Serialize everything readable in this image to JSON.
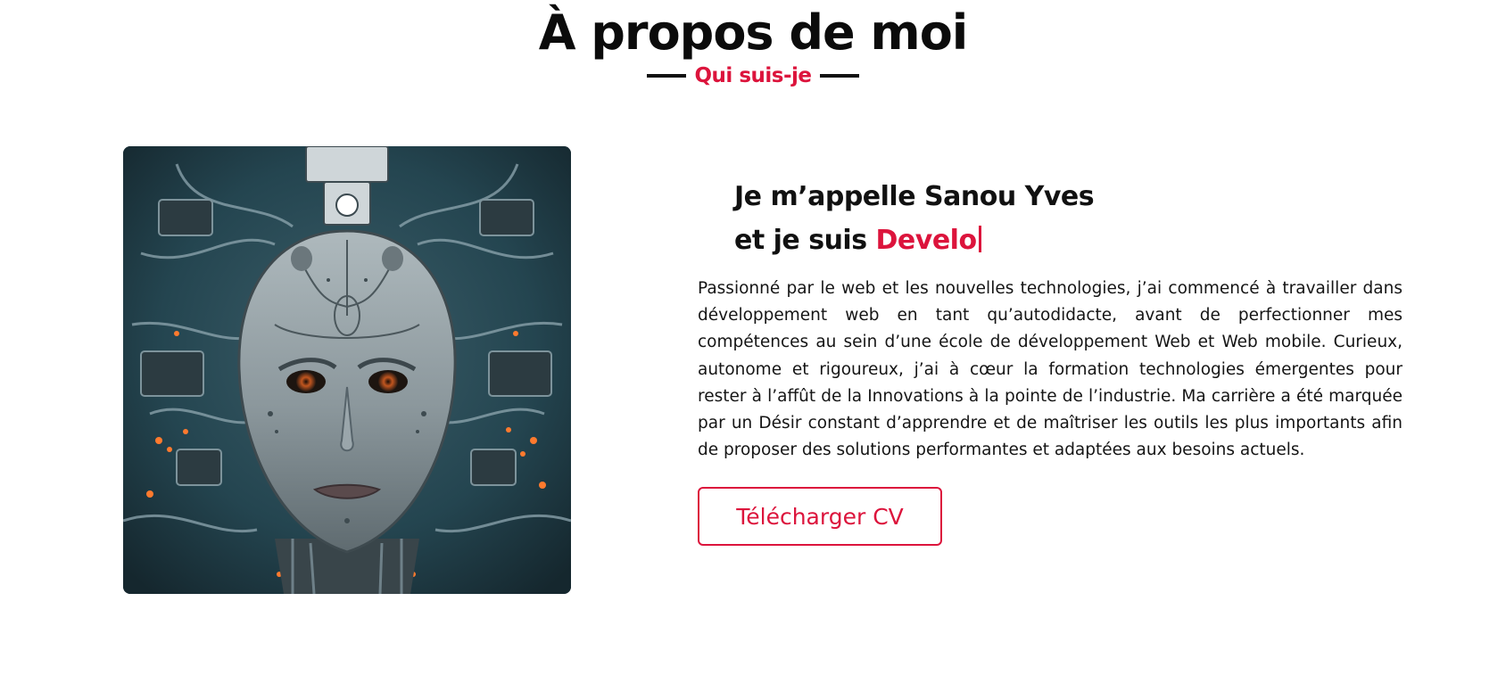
{
  "section": {
    "title": "À propos de moi",
    "subtitle": "Qui suis-je"
  },
  "about": {
    "intro_line1": "Je m’appelle Sanou Yves",
    "intro_line2_prefix": "et je suis ",
    "typed_text": "Develo",
    "bio": "Passionné par le web et les nouvelles technologies, j’ai commencé à travailler dans développement web en tant qu’autodidacte, avant de perfectionner mes compétences au sein d’une école de développement Web et Web mobile. Curieux, autonome et rigoureux, j’ai à cœur la formation technologies émergentes pour rester à l’affût de la Innovations à la pointe de l’industrie. Ma carrière a été marquée par un Désir constant d’apprendre et de maîtriser les outils les plus importants afin de proposer des solutions performantes et adaptées aux besoins actuels.",
    "cv_button_label": "Télécharger CV"
  },
  "colors": {
    "accent": "#dc143c",
    "text": "#111111",
    "background": "#ffffff"
  },
  "icons": {
    "portrait": "robot-face-portrait"
  }
}
